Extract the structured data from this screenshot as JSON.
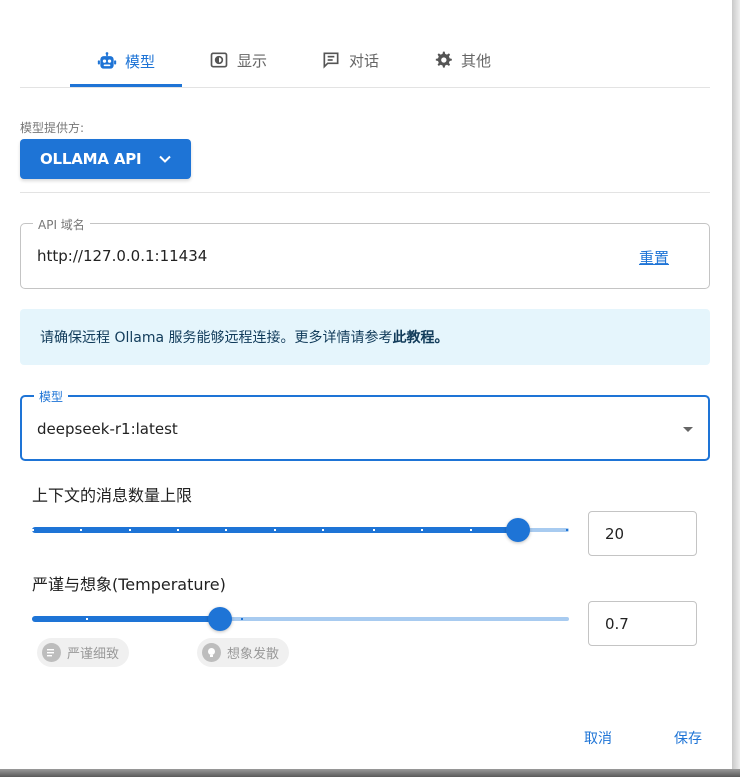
{
  "tabs": [
    {
      "label": "模型",
      "icon": "robot-icon",
      "active": true
    },
    {
      "label": "显示",
      "icon": "display-icon",
      "active": false
    },
    {
      "label": "对话",
      "icon": "chat-icon",
      "active": false
    },
    {
      "label": "其他",
      "icon": "gear-icon",
      "active": false
    }
  ],
  "provider": {
    "label": "模型提供方:",
    "value": "OLLAMA API"
  },
  "api": {
    "legend": "API 域名",
    "value": "http://127.0.0.1:11434",
    "reset": "重置"
  },
  "info": {
    "text": "请确保远程 Ollama 服务能够远程连接。更多详情请参考",
    "link": "此教程",
    "suffix": "。"
  },
  "model": {
    "legend": "模型",
    "value": "deepseek-r1:latest"
  },
  "context": {
    "title": "上下文的消息数量上限",
    "value": "20",
    "fraction": 0.905
  },
  "temperature": {
    "title": "严谨与想象(Temperature)",
    "value": "0.7",
    "fraction": 0.35,
    "chip_left": "严谨细致",
    "chip_right": "想象发散"
  },
  "actions": {
    "cancel": "取消",
    "save": "保存"
  },
  "colors": {
    "accent": "#1e74d6",
    "info_bg": "#e5f5fc"
  }
}
